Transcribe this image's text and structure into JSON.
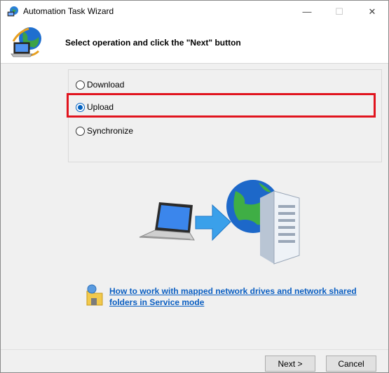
{
  "window": {
    "title": "Automation Task Wizard",
    "caption_buttons": {
      "minimize": "—",
      "maximize": "☐",
      "close": "✕"
    }
  },
  "header": {
    "instruction": "Select operation and click the \"Next\" button"
  },
  "operations": [
    {
      "label": "Download",
      "selected": false
    },
    {
      "label": "Upload",
      "selected": true
    },
    {
      "label": "Synchronize",
      "selected": false
    }
  ],
  "help_link": {
    "text": "How to work with mapped network drives and network shared folders in Service mode"
  },
  "footer": {
    "next_label": "Next >",
    "cancel_label": "Cancel"
  },
  "colors": {
    "highlight": "#e1141e",
    "link": "#0b5fc2",
    "radio_selected": "#0060c0"
  },
  "icons": [
    "app-globe-laptop-icon",
    "wizard-header-icon",
    "laptop-to-server-illustration",
    "help-folder-icon"
  ]
}
